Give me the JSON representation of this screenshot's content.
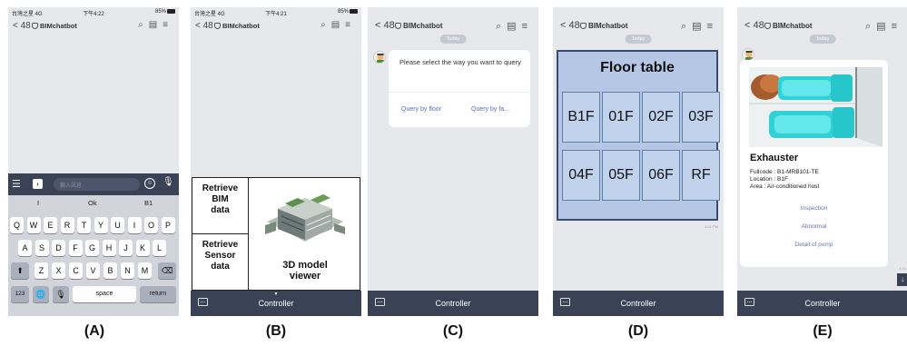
{
  "captions": [
    "(A)",
    "(B)",
    "(C)",
    "(D)",
    "(E)"
  ],
  "colors": {
    "bar": "#3a4256",
    "background": "#e6e8ec",
    "accent_link": "#5a6db8",
    "floor_cell": "#c0d2ec"
  },
  "status_bar": {
    "a": {
      "carrier": "台灣之星 4G",
      "time": "下午4:22",
      "battery": "85%"
    },
    "b": {
      "carrier": "台灣之星 4G",
      "time": "下午4:21",
      "battery": "85%"
    }
  },
  "nav": {
    "back_count": "48",
    "title": "BIMchatbot",
    "icons": [
      "search-icon",
      "list-icon",
      "menu-icon"
    ]
  },
  "today_label": "Today",
  "controller_label": "Controller",
  "screen_a": {
    "input_placeholder": "輸入訊息",
    "suggestions": [
      "I",
      "Ok",
      "B1"
    ],
    "row1": [
      "Q",
      "W",
      "E",
      "R",
      "T",
      "Y",
      "U",
      "I",
      "O",
      "P"
    ],
    "row2": [
      "A",
      "S",
      "D",
      "F",
      "G",
      "H",
      "J",
      "K",
      "L"
    ],
    "row3": [
      "Z",
      "X",
      "C",
      "V",
      "B",
      "N",
      "M"
    ],
    "key_123": "123",
    "key_space": "space",
    "key_return": "return"
  },
  "screen_b": {
    "retrieve_bim": [
      "Retrieve",
      "BIM",
      "data"
    ],
    "retrieve_sensor": [
      "Retrieve",
      "Sensor",
      "data"
    ],
    "model_viewer": [
      "3D model",
      "viewer"
    ]
  },
  "screen_c": {
    "question": "Please select the way you want to query",
    "option_floor": "Query by floor",
    "option_facility": "Query by fa..."
  },
  "screen_d": {
    "title": "Floor table",
    "floors": [
      "B1F",
      "01F",
      "02F",
      "03F",
      "04F",
      "05F",
      "06F",
      "RF"
    ],
    "time": "4:41 PM"
  },
  "screen_e": {
    "title": "Exhauster",
    "fullcode": "Fullcode : B1-MRB101-TE",
    "location": "Location : B1F",
    "area": "Area : Air-conditioned host",
    "links": [
      "Inspection",
      "Abnormal",
      "Detail of pump"
    ],
    "time": "4:43"
  }
}
